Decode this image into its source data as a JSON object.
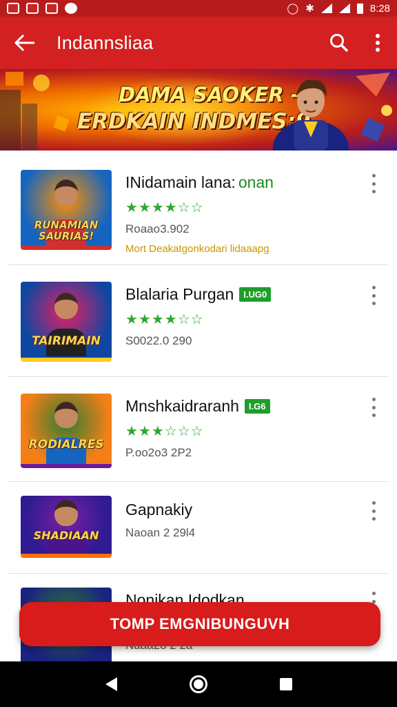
{
  "status_bar": {
    "time": "8:28"
  },
  "app_bar": {
    "title": "Indannsliaa"
  },
  "banner": {
    "line1": "DAMA SAOKER -",
    "line2": "ERDKAIN INDMES:9"
  },
  "items": [
    {
      "title": "INidamain lana:",
      "title_suffix": "onan",
      "badge": "",
      "rating_stars": 5,
      "stars_text": "★★★★☆☆",
      "meta": "Roaao3.902",
      "description": "Mort Deakatgonkodari lidaaapg",
      "thumb_text": "RUNAMIAN SAURIAS!",
      "thumb_colors": [
        "#1565c0",
        "#ff8f00",
        "#d32f2f"
      ]
    },
    {
      "title": "Blalaria Purgan",
      "title_suffix": "",
      "badge": "I.UG0",
      "rating_stars": 5,
      "stars_text": "★★★★☆☆",
      "meta": "S0022.0 290",
      "description": "",
      "thumb_text": "TAIRIMAIN",
      "thumb_colors": [
        "#0d47a1",
        "#e91e63",
        "#ffca28"
      ]
    },
    {
      "title": "Mnshkaidraranh",
      "title_suffix": "",
      "badge": "I.G6",
      "rating_stars": 5,
      "stars_text": "★★★☆☆☆",
      "meta": "P.oo2o3 2P2",
      "description": "",
      "thumb_text": "RODIALRES",
      "thumb_colors": [
        "#f57f17",
        "#2e7d32",
        "#6a1b9a"
      ]
    },
    {
      "title": "Gapnakiy",
      "title_suffix": "",
      "badge": "",
      "rating_stars": 0,
      "stars_text": "",
      "meta": "Naoan 2 29l4",
      "description": "",
      "thumb_text": "SHADIAAN",
      "thumb_colors": [
        "#311b92",
        "#7b1fa2",
        "#ff6f00"
      ]
    },
    {
      "title": "Nonikan Idodkan",
      "title_suffix": "",
      "badge": "",
      "rating_stars": 0,
      "stars_text": "",
      "meta": "Naaa2o 2 2a",
      "description": "",
      "thumb_text": "",
      "thumb_colors": [
        "#1a237e",
        "#2e7d32",
        "#ff8f00"
      ]
    }
  ],
  "floating_button": {
    "label": "TOMP EMGNIBUNGUVH"
  },
  "colors": {
    "primary": "#d32020",
    "status": "#b71c1c",
    "rating": "#2ea82e",
    "badge": "#1e9e2a",
    "desc": "#c99700"
  }
}
